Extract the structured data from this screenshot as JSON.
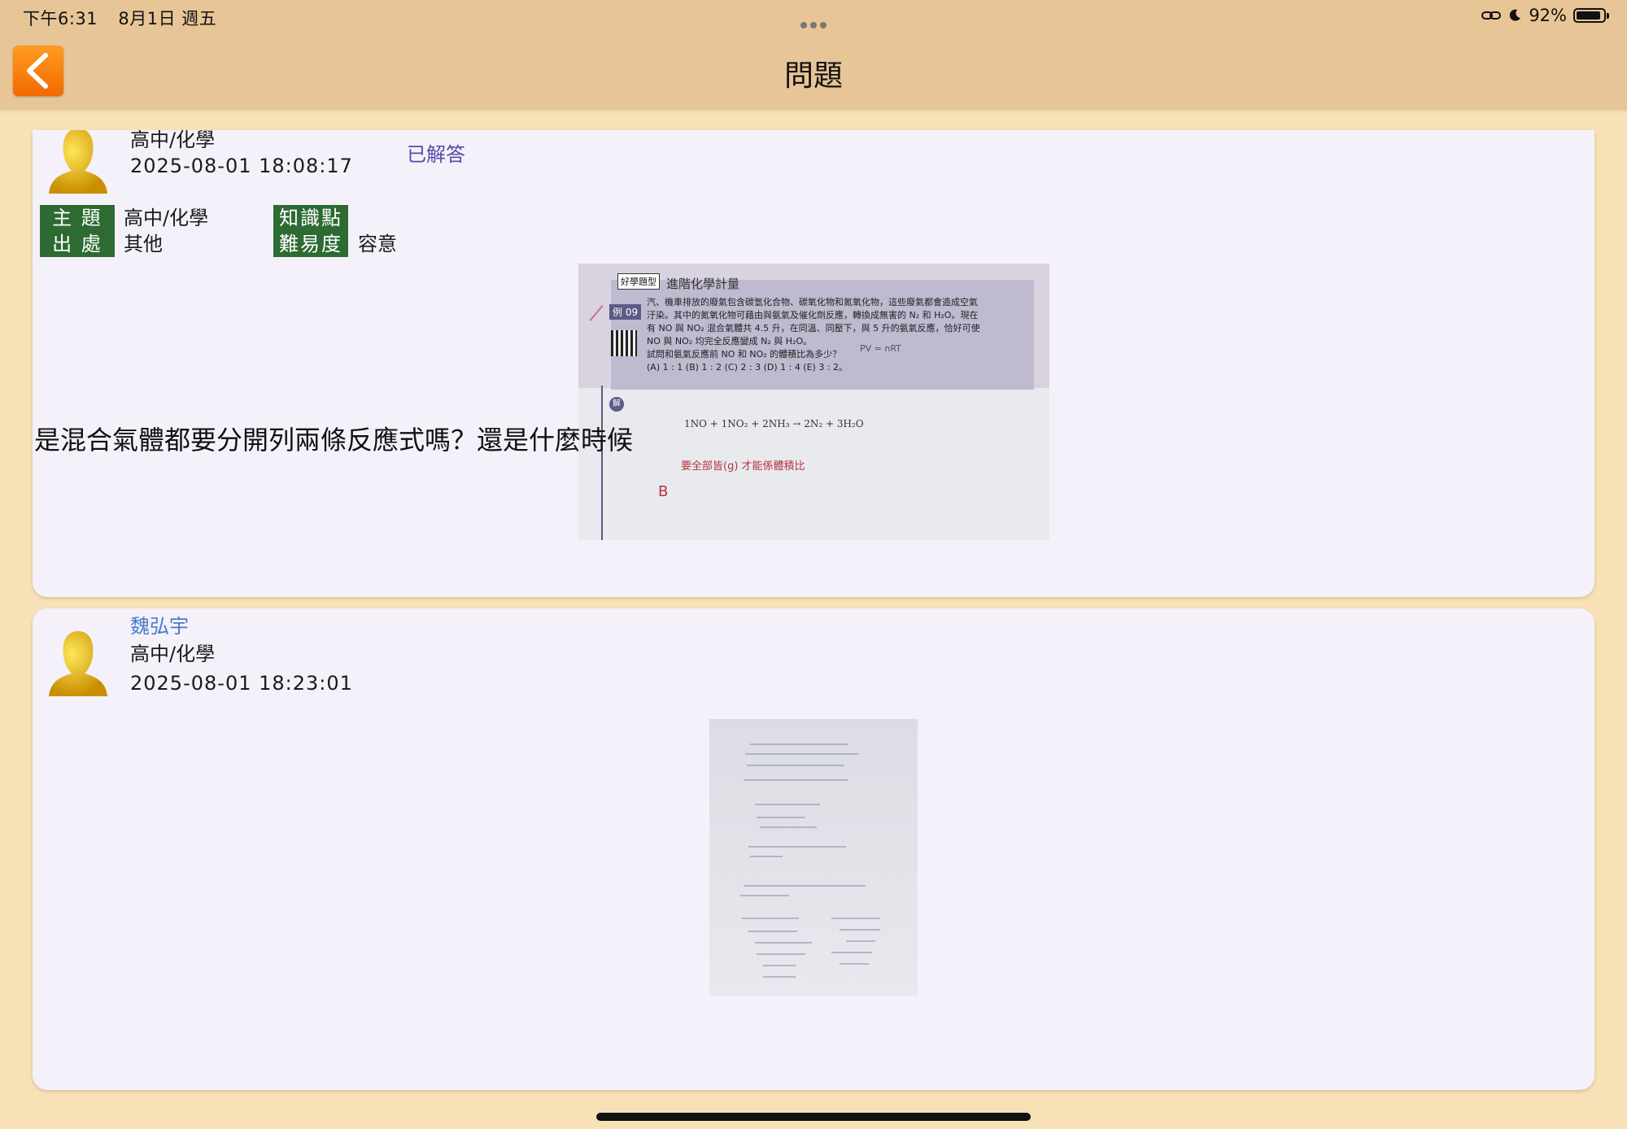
{
  "status": {
    "time": "下午6:31",
    "date": "8月1日 週五",
    "battery": "92%",
    "battery_level": 0.92
  },
  "nav": {
    "title": "問題",
    "back_icon": "chevron-left-icon"
  },
  "post": {
    "subject_line": "高中/化學",
    "datetime": "2025-08-01 18:08:17",
    "status": "已解答",
    "tags": {
      "topic_label": "主 題",
      "topic_value": "高中/化學",
      "knowledge_label": "知識點",
      "knowledge_value": "",
      "source_label": "出 處",
      "source_value": "其他",
      "difficulty_label": "難易度",
      "difficulty_value": "容意"
    },
    "photo_text": {
      "badge": "好學題型",
      "heading": "進階化學計量",
      "example": "例 09",
      "l1": "汽、機車排放的廢氣包含碳氫化合物、碳氧化物和氮氧化物，這些廢氣都會造成空氣",
      "l2": "汙染。其中的氮氧化物可藉由與氨氣及催化劑反應，轉換成無害的 N₂ 和 H₂O。現在",
      "l3": "有 NO 與 NO₂ 混合氣體共 4.5 升，在同溫、同壓下，與 5 升的氨氣反應，恰好可使",
      "l4": "NO 與 NO₂ 均完全反應變成 N₂ 與 H₂O。",
      "l5": "試問和氨氣反應前 NO 和 NO₂ 的體積比為多少？",
      "options": "(A) 1 : 1   (B) 1 : 2   (C) 2 : 3   (D) 1 : 4   (E) 3 : 2。",
      "solution_label": "解",
      "handwritten_eq": "1NO + 1NO₂ + 2NH₃ → 2N₂ + 3H₂O",
      "handwritten_note": "要全部皆(g) 才能係體積比",
      "handwritten_answer": "B",
      "margin_note": "PV = nRT"
    },
    "question": "是混合氣體都要分開列兩條反應式嗎？還是什麼時候"
  },
  "reply": {
    "author": "魏弘宇",
    "subject_line": "高中/化學",
    "datetime": "2025-08-01 18:23:01"
  }
}
